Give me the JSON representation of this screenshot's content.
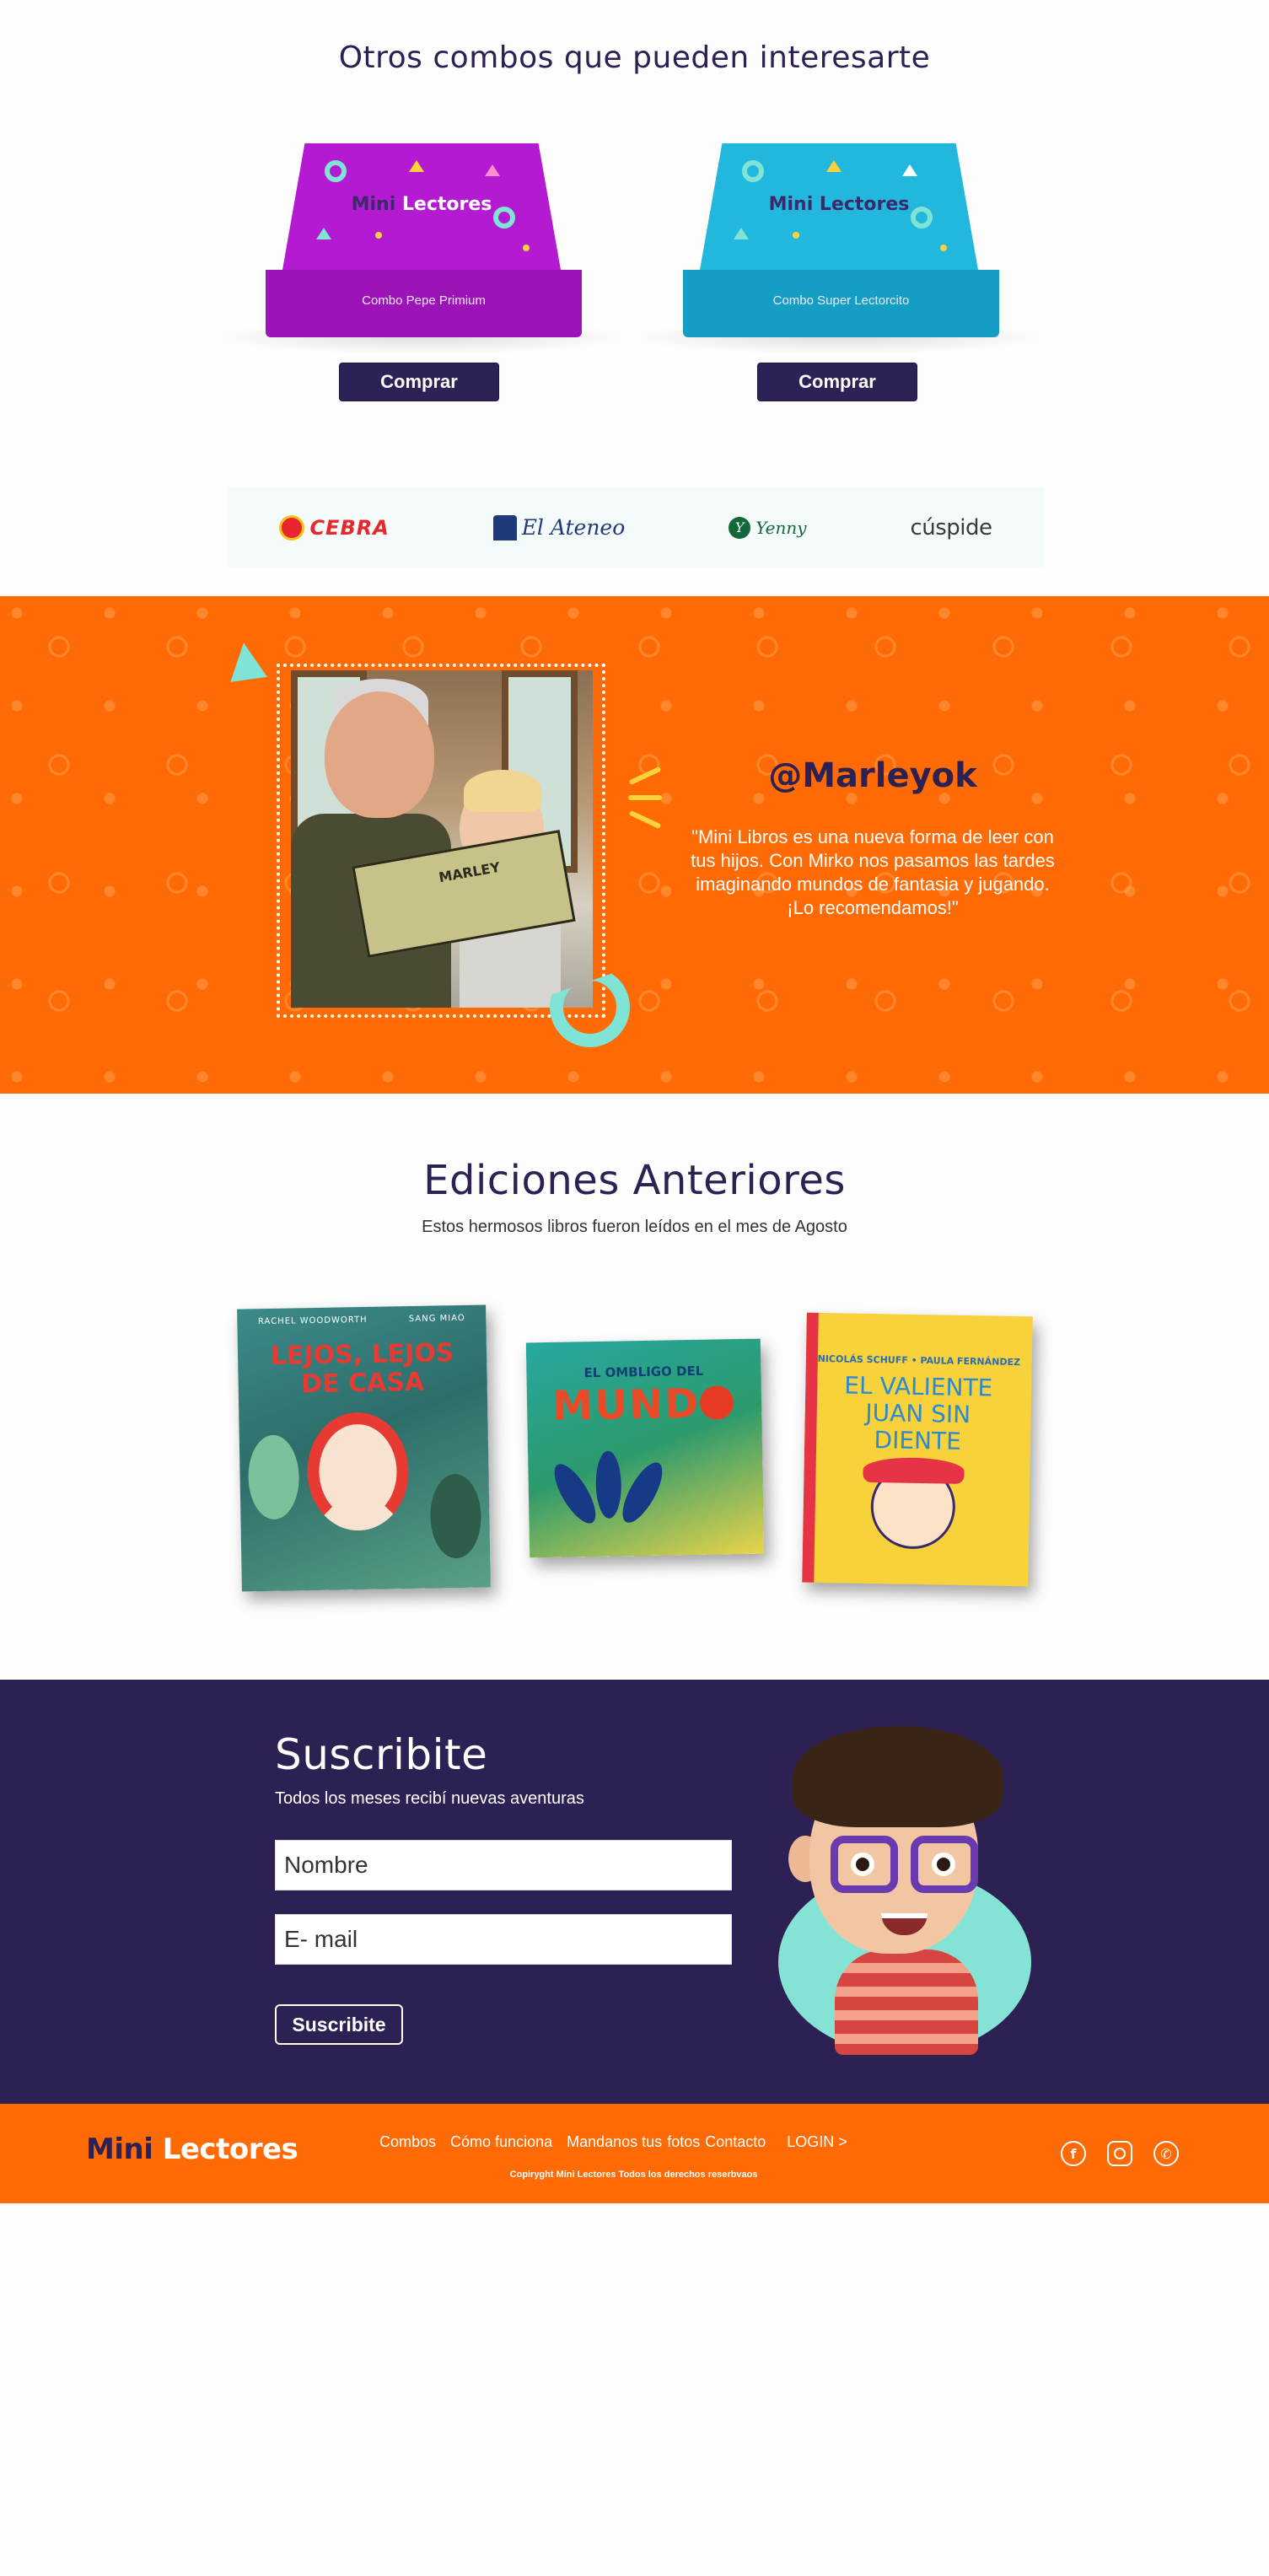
{
  "combos": {
    "title": "Otros combos que pueden interesarte",
    "items": [
      {
        "brand_a": "Mini",
        "brand_b": "Lectores",
        "name": "Combo Pepe Primium",
        "button": "Comprar",
        "color": "#b51ad3"
      },
      {
        "brand_a": "Mini",
        "brand_b": "Lectores",
        "name": "Combo Super Lectorcito",
        "button": "Comprar",
        "color": "#22b8de"
      }
    ]
  },
  "partners": {
    "items": [
      {
        "name": "CEBRA",
        "icon": "cebra-logo-icon"
      },
      {
        "name": "El Ateneo",
        "icon": "ateneo-logo-icon"
      },
      {
        "name": "Yenny",
        "icon": "yenny-logo-icon"
      },
      {
        "name": "cúspide",
        "icon": "cuspide-logo-icon"
      }
    ]
  },
  "testimonial": {
    "handle": "@Marleyok",
    "quote": "\"Mini Libros es una nueva forma de leer con tus hijos. Con Mirko nos pasamos las tardes imaginando mundos de fantasia y jugando. ¡Lo recomendamos!\"",
    "photo_book_title": "MARLEY",
    "background_color": "#fe6a05",
    "accent_color": "#7fe3d6"
  },
  "ediciones": {
    "title": "Ediciones Anteriores",
    "subtitle": "Estos hermosos libros fueron leídos en el mes de Agosto",
    "books": [
      {
        "authors": [
          "RACHEL WOODWORTH",
          "SANG MIAO"
        ],
        "title": "LEJOS, LEJOS DE CASA"
      },
      {
        "title_top": "EL OMBLIGO DEL",
        "title_big": "MUNDO"
      },
      {
        "author": "NICOLÁS SCHUFF • PAULA FERNÁNDEZ",
        "title": "EL VALIENTE JUAN SIN DIENTE"
      }
    ]
  },
  "subscribe": {
    "title": "Suscribite",
    "lead": "Todos los meses recibí nuevas aventuras",
    "name_placeholder": "Nombre",
    "email_placeholder": "E- mail",
    "button": "Suscribite",
    "background_color": "#2c2152"
  },
  "footer": {
    "logo_a": "Mini",
    "logo_b": "Lectores",
    "nav": [
      "Combos",
      "Cómo funciona",
      "Mandanos tus",
      "fotos",
      "Contacto",
      "LOGIN >"
    ],
    "copyright": "Copiryght Mini Lectores Todos los derechos reserbvaos",
    "social": [
      {
        "icon": "facebook-icon",
        "glyph": "f"
      },
      {
        "icon": "instagram-icon",
        "glyph": ""
      },
      {
        "icon": "whatsapp-icon",
        "glyph": "✆"
      }
    ]
  }
}
